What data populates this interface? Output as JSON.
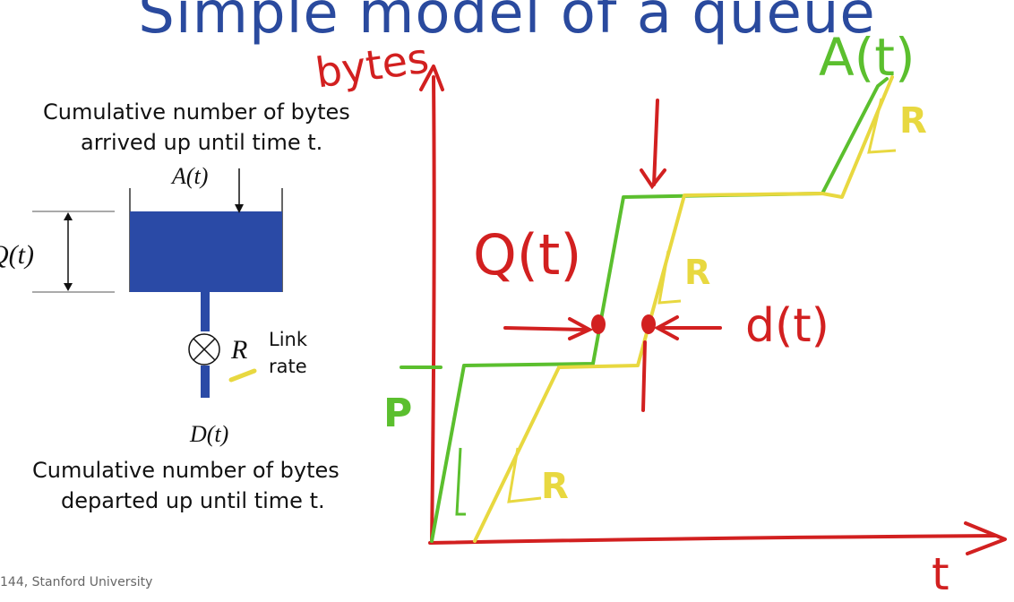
{
  "slide": {
    "title": "Simple model of a queue",
    "footer": "144, Stanford University"
  },
  "model": {
    "arrivals_caption_line1": "Cumulative number of bytes",
    "arrivals_caption_line2": "arrived up until time t.",
    "departures_caption_line1": "Cumulative number of bytes",
    "departures_caption_line2": "departed up until time t.",
    "arrival_label": "A(t)",
    "queue_label": "Q(t)",
    "rate_symbol": "R",
    "rate_text_line1": "Link",
    "rate_text_line2": "rate",
    "departure_label": "D(t)"
  },
  "annotations": {
    "y_axis": "bytes",
    "x_axis": "t",
    "arrival_curve": "A(t)",
    "queue": "Q(t)",
    "delay": "d(t)",
    "packet_size": "P",
    "slope_label": "R"
  },
  "colors": {
    "title": "#2a4a9e",
    "tank_fill": "#2a4aa6",
    "axes_ink": "#d22020",
    "arrival_ink": "#5bbf2e",
    "departure_ink": "#e8d840"
  }
}
